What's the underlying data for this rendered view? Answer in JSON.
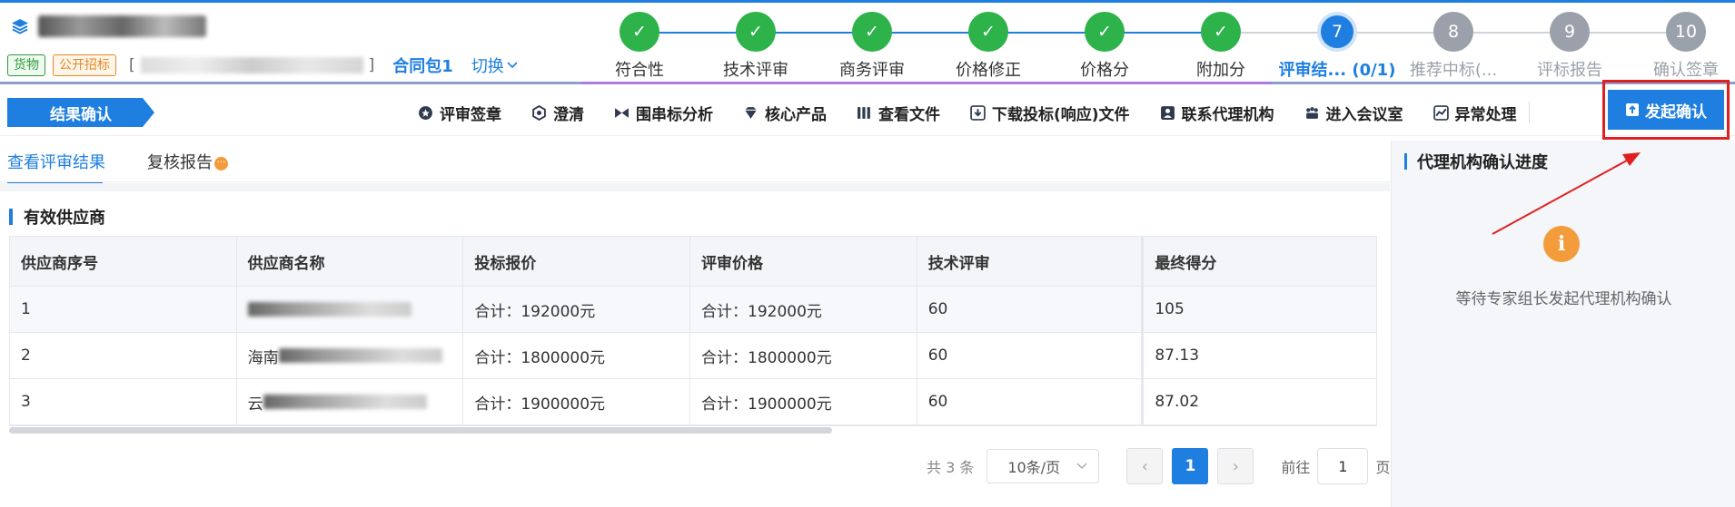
{
  "header": {
    "tags": [
      "货物",
      "公开招标"
    ],
    "code_open": "[",
    "code_close": "]",
    "package": "合同包1",
    "switch_label": "切换"
  },
  "steps": [
    {
      "label": "符合性",
      "state": "done"
    },
    {
      "label": "技术评审",
      "state": "done"
    },
    {
      "label": "商务评审",
      "state": "done"
    },
    {
      "label": "价格修正",
      "state": "done"
    },
    {
      "label": "价格分",
      "state": "done"
    },
    {
      "label": "附加分",
      "state": "done"
    },
    {
      "label": "评审结...",
      "num": "7",
      "extra": "(0/1)",
      "state": "current"
    },
    {
      "label": "推荐中标(...",
      "num": "8",
      "state": "todo"
    },
    {
      "label": "评标报告",
      "num": "9",
      "state": "todo"
    },
    {
      "label": "确认签章",
      "num": "10",
      "state": "todo"
    }
  ],
  "toolbar": {
    "result_tag": "结果确认",
    "items": [
      {
        "label": "评审签章",
        "icon": "seal-icon"
      },
      {
        "label": "澄清",
        "icon": "hexagon-icon"
      },
      {
        "label": "围串标分析",
        "icon": "bowtie-icon"
      },
      {
        "label": "核心产品",
        "icon": "diamond-icon"
      },
      {
        "label": "查看文件",
        "icon": "file-stack-icon"
      },
      {
        "label": "下载投标(响应)文件",
        "icon": "download-icon"
      },
      {
        "label": "联系代理机构",
        "icon": "contact-icon"
      },
      {
        "label": "进入会议室",
        "icon": "meeting-icon"
      },
      {
        "label": "异常处理",
        "icon": "chart-icon"
      }
    ],
    "start_confirm": "发起确认"
  },
  "tabs": [
    "查看评审结果",
    "复核报告"
  ],
  "section_title": "有效供应商",
  "table": {
    "headers": [
      "供应商序号",
      "供应商名称",
      "投标报价",
      "评审价格",
      "技术评审",
      "最终得分"
    ],
    "rows": [
      {
        "no": "1",
        "name_prefix": "",
        "bid": "合计：192000元",
        "eval": "合计：192000元",
        "tech": "60",
        "score": "105"
      },
      {
        "no": "2",
        "name_prefix": "海南",
        "bid": "合计：1800000元",
        "eval": "合计：1800000元",
        "tech": "60",
        "score": "87.13"
      },
      {
        "no": "3",
        "name_prefix": "云",
        "bid": "合计：1900000元",
        "eval": "合计：1900000元",
        "tech": "60",
        "score": "87.02"
      }
    ]
  },
  "pagination": {
    "total": "共 3 条",
    "page_size": "10条/页",
    "current": "1",
    "goto_label": "前往",
    "goto_value": "1",
    "page_suffix": "页"
  },
  "right_panel": {
    "title": "代理机构确认进度",
    "message": "等待专家组长发起代理机构确认"
  },
  "colors": {
    "primary": "#1f7fe0",
    "success": "#2db34a",
    "warning": "#f39c3c",
    "highlight": "#e02020"
  }
}
